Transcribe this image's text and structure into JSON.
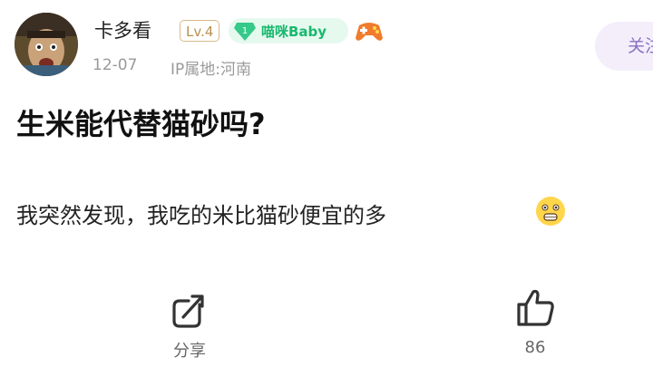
{
  "post": {
    "author": {
      "name": "卡多看",
      "level_badge": "Lv.4",
      "fan_badge_level": "1",
      "fan_badge_name": "喵咪Baby",
      "date": "12-07",
      "ip_location": "IP属地:河南"
    },
    "follow_button": "关注",
    "title": "生米能代替猫砂吗?",
    "content": "我突然发现，我吃的米比猫砂便宜的多",
    "actions": {
      "share_label": "分享",
      "like_count": "86"
    }
  },
  "colors": {
    "fan_badge_bg": "#e6f9ef",
    "fan_badge_text": "#18b96e",
    "level_badge": "#b8904f",
    "follow_bg": "#f4eefb",
    "follow_text": "#8a6fc4"
  },
  "icons": [
    "avatar",
    "gem-icon",
    "gamepad-icon",
    "surprised-emoji-icon",
    "share-icon",
    "thumbs-up-icon"
  ]
}
